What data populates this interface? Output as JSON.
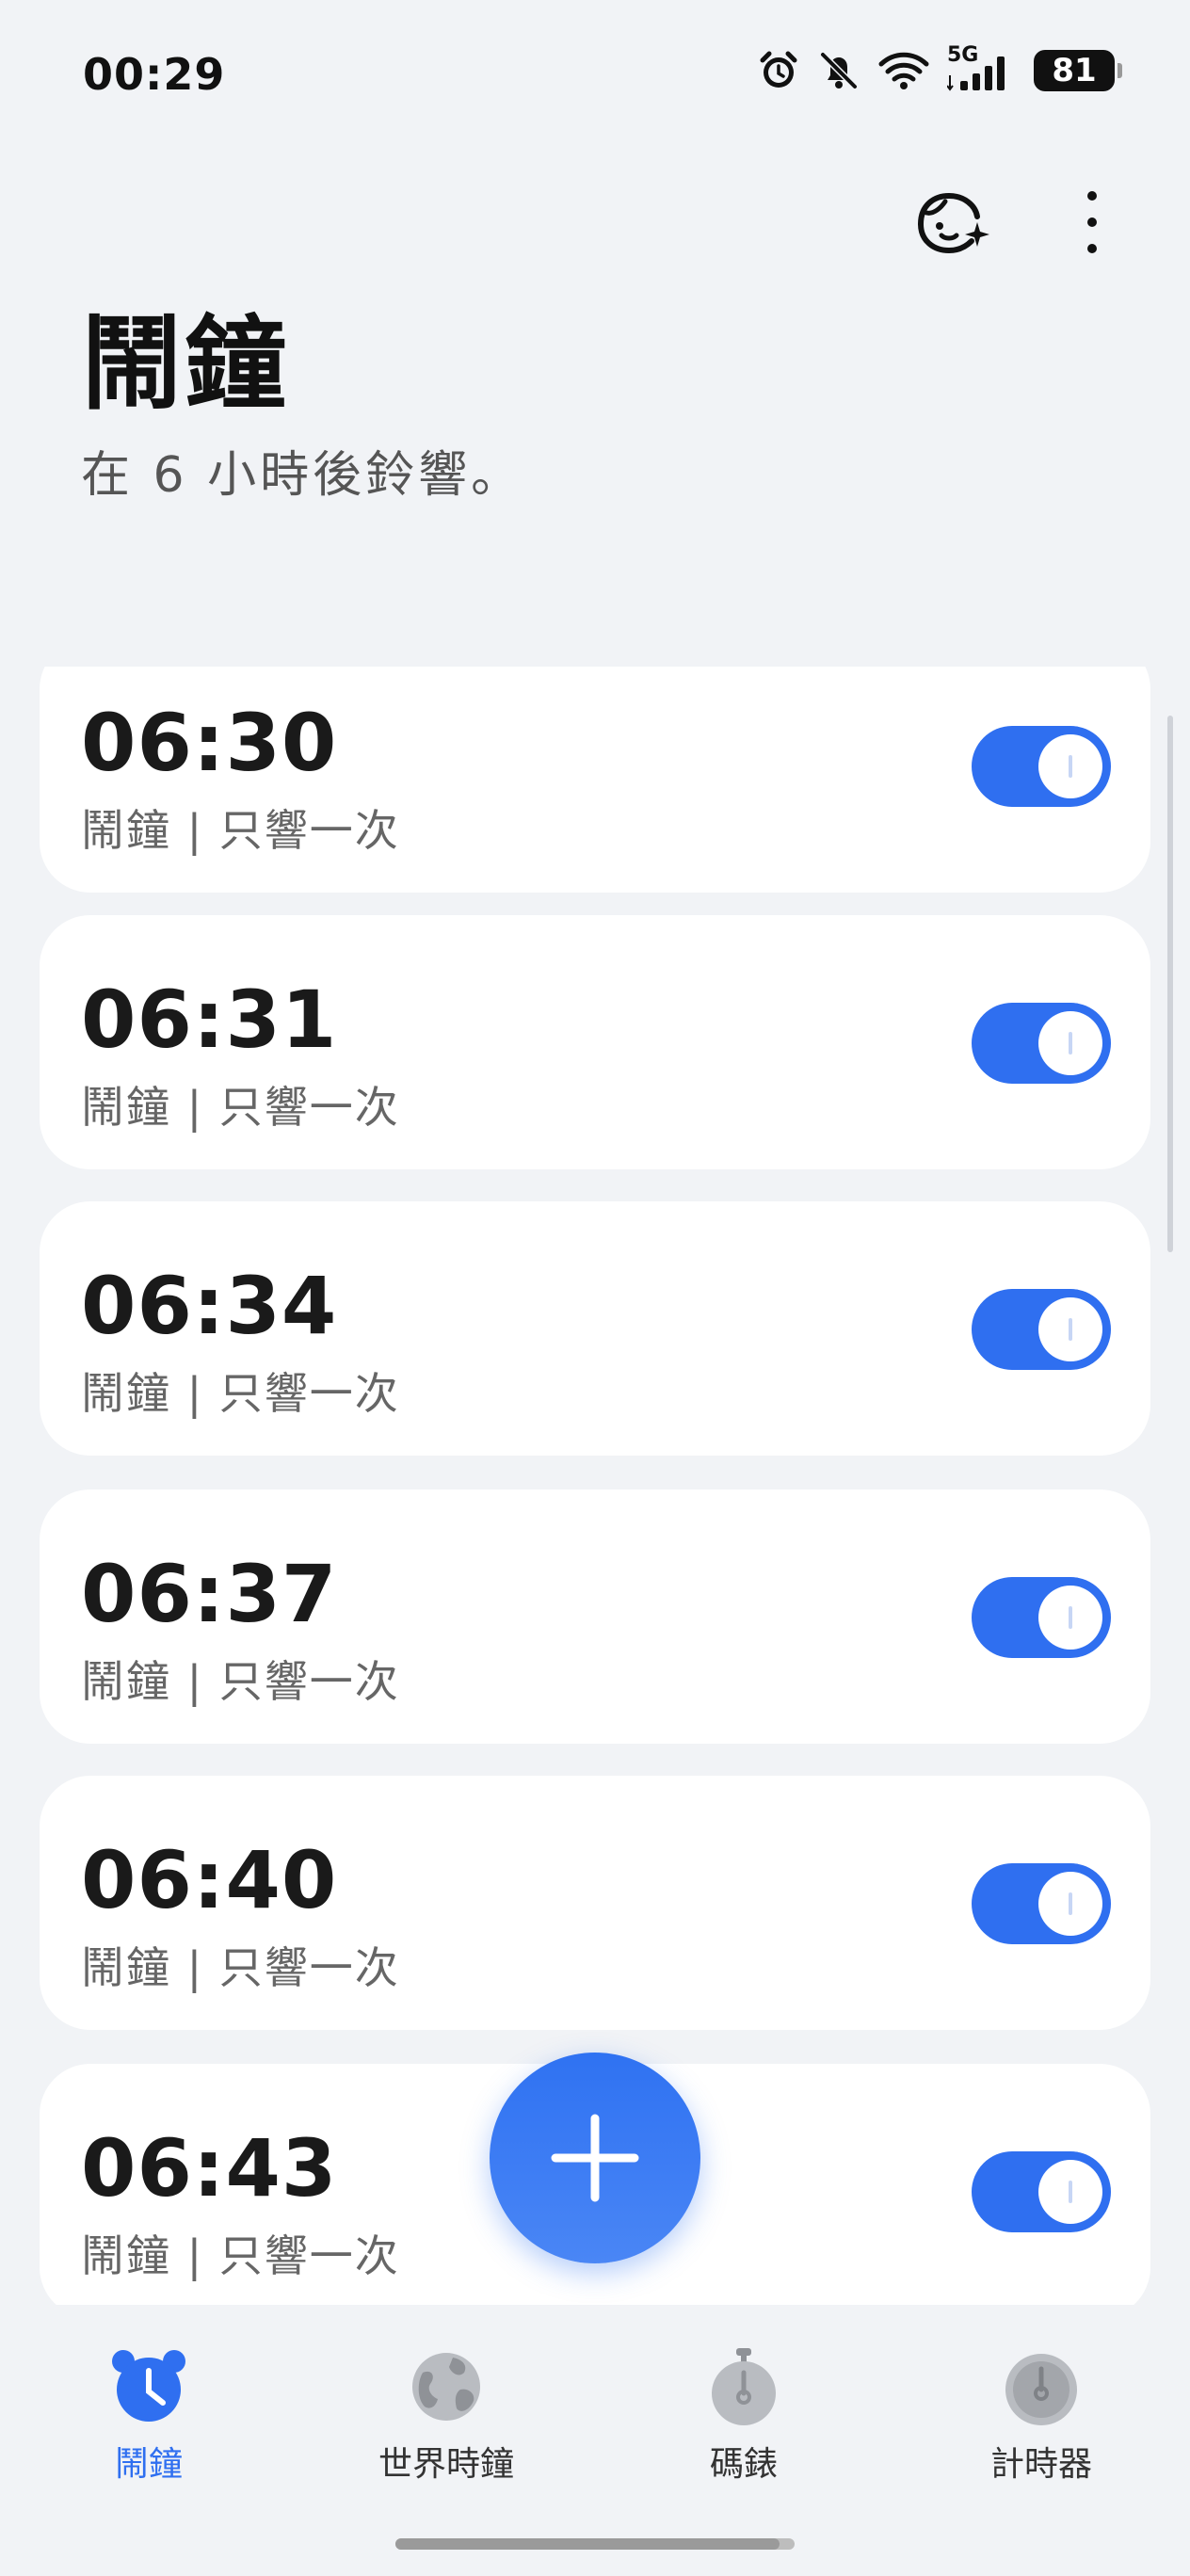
{
  "status_bar": {
    "time": "00:29",
    "network": "5G",
    "battery": "81",
    "icons": [
      "alarm-icon",
      "bell-off-icon",
      "wifi-icon",
      "signal-icon",
      "battery-icon"
    ]
  },
  "header": {
    "title": "鬧鐘",
    "subtitle": "在 6 小時後鈴響。",
    "actions": [
      "assistant-face-icon",
      "more-vert-icon"
    ]
  },
  "alarms": [
    {
      "time": "06:30",
      "label": "鬧鐘 | 只響一次",
      "enabled": true
    },
    {
      "time": "06:31",
      "label": "鬧鐘 | 只響一次",
      "enabled": true
    },
    {
      "time": "06:34",
      "label": "鬧鐘 | 只響一次",
      "enabled": true
    },
    {
      "time": "06:37",
      "label": "鬧鐘 | 只響一次",
      "enabled": true
    },
    {
      "time": "06:40",
      "label": "鬧鐘 | 只響一次",
      "enabled": true
    },
    {
      "time": "06:43",
      "label": "鬧鐘 | 只響一次",
      "enabled": true
    }
  ],
  "fab": {
    "icon": "plus-icon"
  },
  "bottom_nav": [
    {
      "label": "鬧鐘",
      "icon": "alarm-clock-icon",
      "active": true
    },
    {
      "label": "世界時鐘",
      "icon": "globe-icon",
      "active": false
    },
    {
      "label": "碼錶",
      "icon": "stopwatch-icon",
      "active": false
    },
    {
      "label": "計時器",
      "icon": "timer-icon",
      "active": false
    }
  ],
  "colors": {
    "accent": "#2f6ff0",
    "background": "#f1f3f6",
    "card": "#ffffff",
    "inactive_icon": "#a8abb0"
  }
}
